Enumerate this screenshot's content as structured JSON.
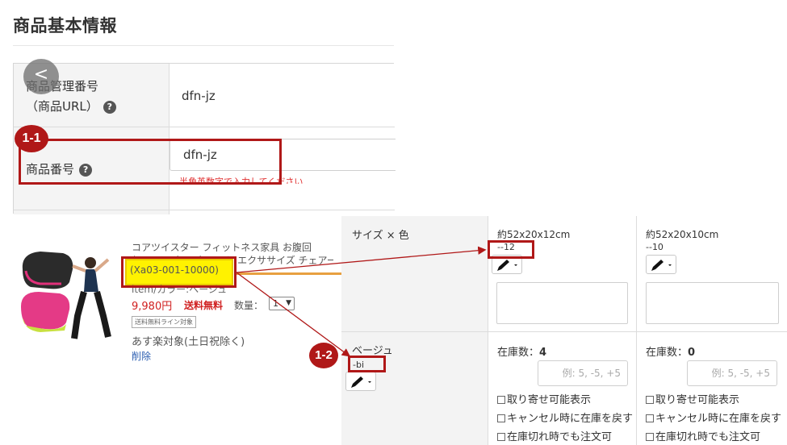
{
  "top": {
    "title": "商品基本情報",
    "row1_label_line1": "商品管理番号",
    "row1_label_line2": "（商品URL）",
    "row1_value": "dfn-jz",
    "row2_label": "商品番号",
    "row2_input_value": "dfn-jz",
    "help_icon": "?",
    "back_icon": "<"
  },
  "badges": {
    "b1": "1-1",
    "b2": "1-2"
  },
  "product": {
    "name_line1": "コアツイスター フィットネス家具 お腹回",
    "name_line2": "り ツイスター ウエスト エクササイズ チェアー 【送料無料】",
    "code": "(Xa03-001-10000)",
    "color_line": "item/カラー:ベージュ",
    "price": "9,980円",
    "shipping": "送料無料",
    "qty_label": "数量：",
    "qty_value": "1",
    "tag": "送料無料ライン対象",
    "delivery": "あす楽対象(土日祝除く)",
    "delete": "削除"
  },
  "grid": {
    "header_label": "サイズ × 色",
    "col1_title": "約52x20x12cm",
    "col1_code": "--12",
    "col2_title": "約52x20x10cm",
    "col2_code": "--10",
    "row_label": "ベージュ",
    "row_code": "-bi",
    "col1_stock_label": "在庫数：",
    "col1_stock_value": "4",
    "col2_stock_label": "在庫数：",
    "col2_stock_value": "0",
    "stock_placeholder": "例: 5, -5, +5",
    "check1": "取り寄せ可能表示",
    "check2": "キャンセル時に在庫を戻す",
    "check3": "在庫切れ時でも注文可"
  },
  "colors": {
    "accent_red": "#b01818",
    "highlight_yellow": "#fff200",
    "price_red": "#d02020"
  },
  "icons": [
    "chevron-left-icon",
    "help-icon",
    "pencil-icon",
    "caret-down-icon"
  ]
}
